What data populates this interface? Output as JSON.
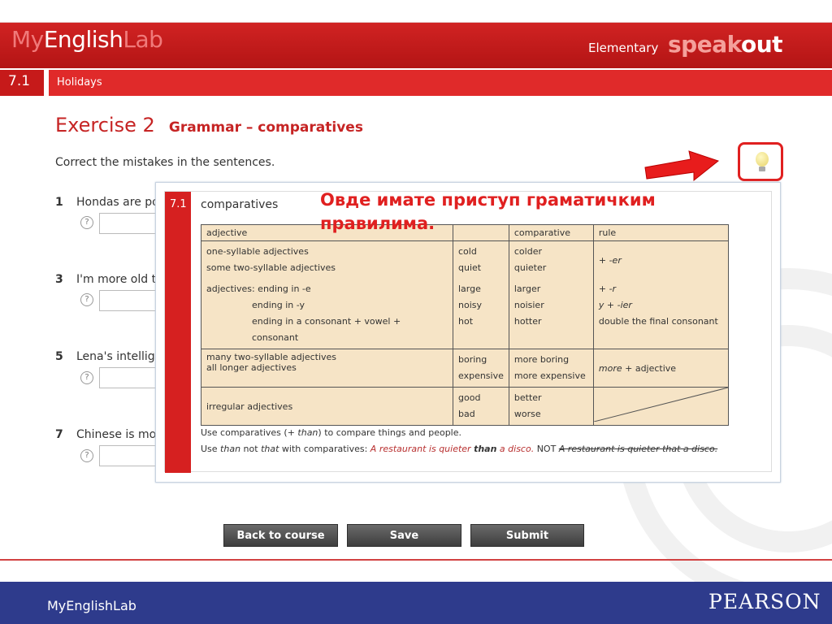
{
  "header": {
    "logo_my": "My",
    "logo_english": "English",
    "logo_lab": "Lab",
    "level": "Elementary",
    "brand_speak": "speak",
    "brand_out": "out"
  },
  "unit": {
    "number": "7.1",
    "title": "Holidays"
  },
  "exercise": {
    "title": "Exercise 2",
    "subtitle": "Grammar – comparatives",
    "instruction": "Correct the mistakes in the sentences."
  },
  "questions": [
    {
      "number": "1",
      "text": "Hondas are po"
    },
    {
      "number": "3",
      "text": "I'm more old t"
    },
    {
      "number": "5",
      "text": "Lena's intellig"
    },
    {
      "number": "7",
      "text": "Chinese is mo"
    }
  ],
  "help_label": "?",
  "annotation": {
    "line1": "Овде имате приступ граматичким",
    "line2": "правилима."
  },
  "grammar": {
    "unit": "7.1",
    "heading": "comparatives",
    "headers": {
      "adjective": "adjective",
      "comparative": "comparative",
      "rule": "rule"
    },
    "row1": {
      "adj": [
        "one-syllable adjectives",
        "some two-syllable adjectives"
      ],
      "ex": [
        "cold",
        "quiet"
      ],
      "comp": [
        "colder",
        "quieter"
      ],
      "rule": "+ -er"
    },
    "row2": {
      "adj": [
        "adjectives: ending in -e",
        "ending in -y",
        "ending in a consonant + vowel + consonant"
      ],
      "ex": [
        "large",
        "noisy",
        "hot"
      ],
      "comp": [
        "larger",
        "noisier",
        "hotter"
      ],
      "rule": [
        "+ -r",
        "y + -ier",
        "double the final consonant"
      ]
    },
    "row3": {
      "adj": [
        "many two-syllable adjectives",
        "all longer adjectives"
      ],
      "ex": [
        "boring",
        "expensive"
      ],
      "comp": [
        "more boring",
        "more expensive"
      ],
      "rule_more": "more",
      "rule_rest": " + adjective"
    },
    "row4": {
      "adj": "irregular adjectives",
      "ex": [
        "good",
        "bad"
      ],
      "comp": [
        "better",
        "worse"
      ]
    },
    "note1_a": "Use comparatives (+ ",
    "note1_than": "than",
    "note1_b": ") to compare things and people.",
    "note2_a": "Use ",
    "note2_than": "than",
    "note2_b": " not ",
    "note2_that": "that",
    "note2_c": " with comparatives: ",
    "note2_ex1": "A restaurant is quieter ",
    "note2_ex_than": "than",
    "note2_ex2": " a disco.",
    "note2_not": " NOT ",
    "note2_wrong": "A restaurant is quieter that a disco."
  },
  "buttons": {
    "back": "Back to course",
    "save": "Save",
    "submit": "Submit"
  },
  "footer": {
    "left": "MyEnglishLab",
    "right": "PEARSON"
  },
  "colors": {
    "brand_red": "#c61a1a",
    "footer_blue": "#2e3b8c",
    "table_bg": "#f6e4c6"
  }
}
